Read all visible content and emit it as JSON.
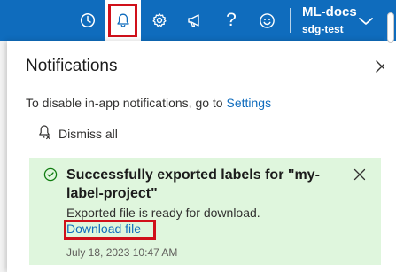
{
  "topbar": {
    "icons": [
      "clock-icon",
      "bell-icon",
      "gear-icon",
      "megaphone-icon",
      "help-icon",
      "smiley-icon"
    ],
    "help_glyph": "?",
    "workspace_name": "ML-docs",
    "workspace_sub": "sdg-test"
  },
  "panel": {
    "title": "Notifications",
    "hint_text": "To disable in-app notifications, go to ",
    "hint_link": "Settings",
    "dismiss_all": "Dismiss all"
  },
  "notification": {
    "status": "success",
    "title": "Successfully exported labels for \"my-label-project\"",
    "body": "Exported file is ready for download.",
    "link": "Download file",
    "timestamp": "July 18, 2023 10:47 AM"
  },
  "colors": {
    "brand": "#0f6cbd",
    "success_bg": "#dff6dd",
    "success_icon": "#107c10",
    "highlight": "#d0101a"
  }
}
